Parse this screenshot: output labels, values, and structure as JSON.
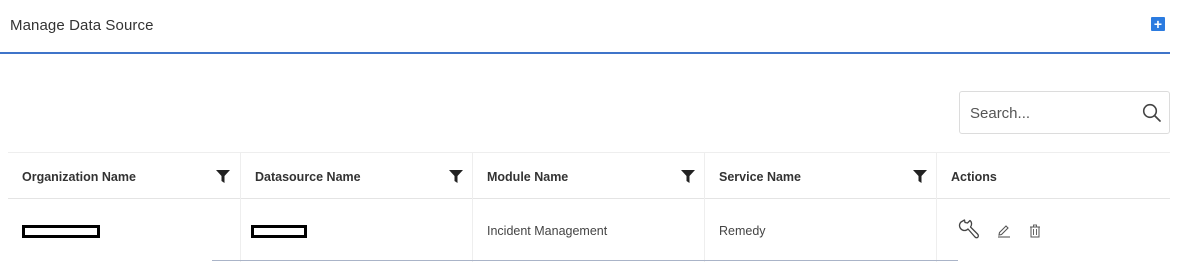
{
  "header": {
    "title": "Manage Data Source",
    "add_icon": "plus-square-icon",
    "accent_color": "#3f74c9"
  },
  "search": {
    "placeholder": "Search...",
    "value": "",
    "icon": "search-icon"
  },
  "table": {
    "columns": [
      {
        "label": "Organization Name",
        "filter": true
      },
      {
        "label": "Datasource Name",
        "filter": true
      },
      {
        "label": "Module Name",
        "filter": true
      },
      {
        "label": "Service Name",
        "filter": true
      },
      {
        "label": "Actions",
        "filter": false
      }
    ],
    "rows": [
      {
        "organization_name": "",
        "datasource_name": "",
        "module_name": "Incident Management",
        "service_name": "Remedy",
        "actions": [
          "wrench-icon",
          "edit-pencil-icon",
          "trash-icon"
        ]
      }
    ]
  }
}
